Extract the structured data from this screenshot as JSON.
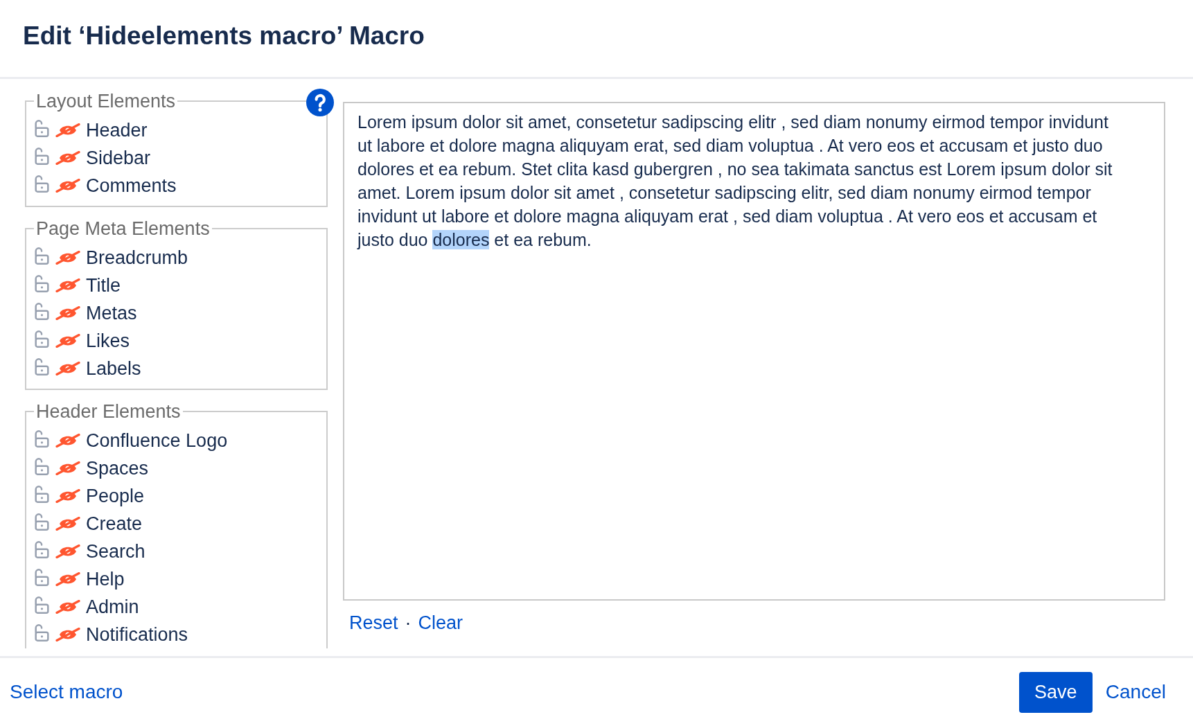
{
  "dialog": {
    "title": "Edit ‘Hideelements macro’ Macro"
  },
  "element_groups": [
    {
      "legend": "Layout Elements",
      "items": [
        {
          "label": "Header",
          "locked": false,
          "hidden": true
        },
        {
          "label": "Sidebar",
          "locked": false,
          "hidden": true
        },
        {
          "label": "Comments",
          "locked": false,
          "hidden": true
        }
      ]
    },
    {
      "legend": "Page Meta Elements",
      "items": [
        {
          "label": "Breadcrumb",
          "locked": false,
          "hidden": true
        },
        {
          "label": "Title",
          "locked": false,
          "hidden": true
        },
        {
          "label": "Metas",
          "locked": false,
          "hidden": true
        },
        {
          "label": "Likes",
          "locked": false,
          "hidden": true
        },
        {
          "label": "Labels",
          "locked": false,
          "hidden": true
        }
      ]
    },
    {
      "legend": "Header Elements",
      "items": [
        {
          "label": "Confluence Logo",
          "locked": false,
          "hidden": true
        },
        {
          "label": "Spaces",
          "locked": false,
          "hidden": true
        },
        {
          "label": "People",
          "locked": false,
          "hidden": true
        },
        {
          "label": "Create",
          "locked": false,
          "hidden": true
        },
        {
          "label": "Search",
          "locked": false,
          "hidden": true
        },
        {
          "label": "Help",
          "locked": false,
          "hidden": true
        },
        {
          "label": "Admin",
          "locked": false,
          "hidden": true
        },
        {
          "label": "Notifications",
          "locked": false,
          "hidden": true
        }
      ]
    }
  ],
  "editor": {
    "content": [
      {
        "text": "Lorem ipsum dolor sit amet, consetetur sadipscing elitr , sed diam nonumy eirmod tempor invidunt ut labore et dolore magna aliquyam erat, sed diam voluptua . At vero eos et accusam et justo duo dolores et ea rebum. Stet clita kasd gubergren , no sea takimata sanctus est Lorem ipsum dolor sit amet. Lorem ipsum dolor sit amet , consetetur sadipscing elitr, sed diam nonumy eirmod tempor invidunt ut labore et dolore magna aliquyam erat , sed diam voluptua . At vero eos et accusam et justo duo ",
        "selected": false
      },
      {
        "text": "dolores",
        "selected": true
      },
      {
        "text": " et ea rebum.",
        "selected": false
      }
    ]
  },
  "editor_links": {
    "items": [
      "Reset",
      "Clear"
    ],
    "separator": "·"
  },
  "footer": {
    "select_macro": "Select macro",
    "buttons": [
      {
        "label": "Save",
        "kind": "primary"
      },
      {
        "label": "Cancel",
        "kind": "link"
      }
    ]
  }
}
